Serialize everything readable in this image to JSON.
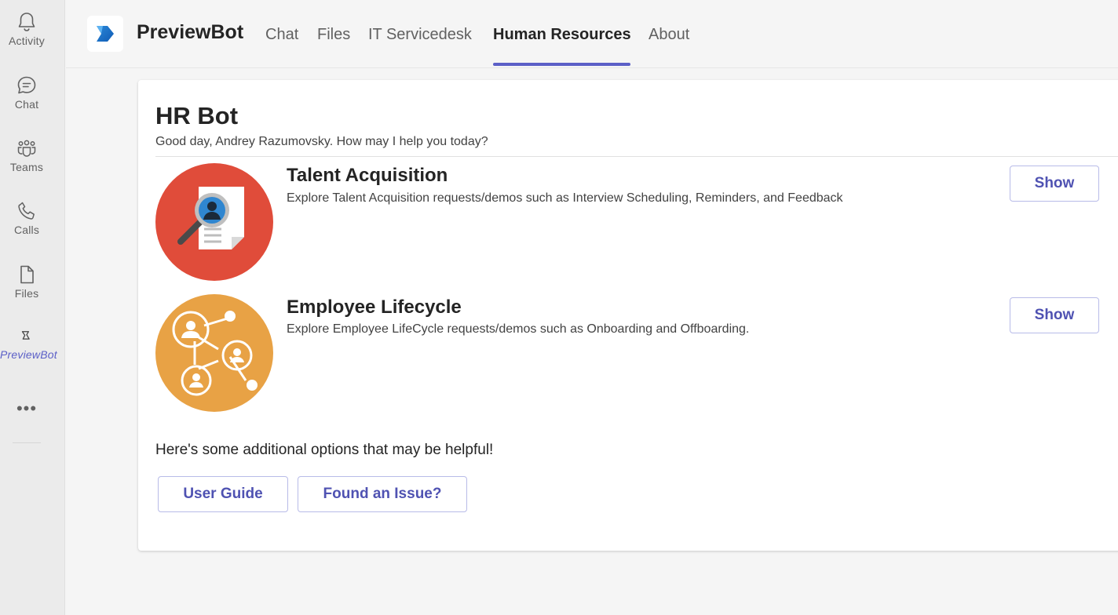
{
  "rail": {
    "items": [
      {
        "label": "Activity",
        "icon": "bell-icon"
      },
      {
        "label": "Chat",
        "icon": "chat-icon"
      },
      {
        "label": "Teams",
        "icon": "teams-icon"
      },
      {
        "label": "Calls",
        "icon": "phone-icon"
      },
      {
        "label": "Files",
        "icon": "file-icon"
      },
      {
        "label": "PreviewBot",
        "icon": "previewbot-icon"
      }
    ],
    "more": "•••"
  },
  "header": {
    "app_name": "PreviewBot",
    "tabs": [
      {
        "label": "Chat"
      },
      {
        "label": "Files"
      },
      {
        "label": "IT Servicedesk"
      },
      {
        "label": "Human Resources",
        "active": true
      },
      {
        "label": "About"
      }
    ]
  },
  "card": {
    "title": "HR Bot",
    "subtitle": "Good day, Andrey Razumovsky. How may I help you today?",
    "items": [
      {
        "title": "Talent Acquisition",
        "description": "Explore Talent Acquisition requests/demos such as Interview Scheduling, Reminders, and Feedback",
        "button": "Show",
        "icon": "talent-acquisition-icon"
      },
      {
        "title": "Employee Lifecycle",
        "description": "Explore Employee LifeCycle requests/demos such as Onboarding and Offboarding.",
        "button": "Show",
        "icon": "employee-network-icon"
      }
    ],
    "additional_text": "Here's some additional options that may be helpful!",
    "user_guide": "User Guide",
    "found_issue": "Found an Issue?"
  },
  "colors": {
    "accent": "#5b5fc7",
    "talent_red": "#e04c3a",
    "lifecycle_orange": "#e8a245"
  }
}
